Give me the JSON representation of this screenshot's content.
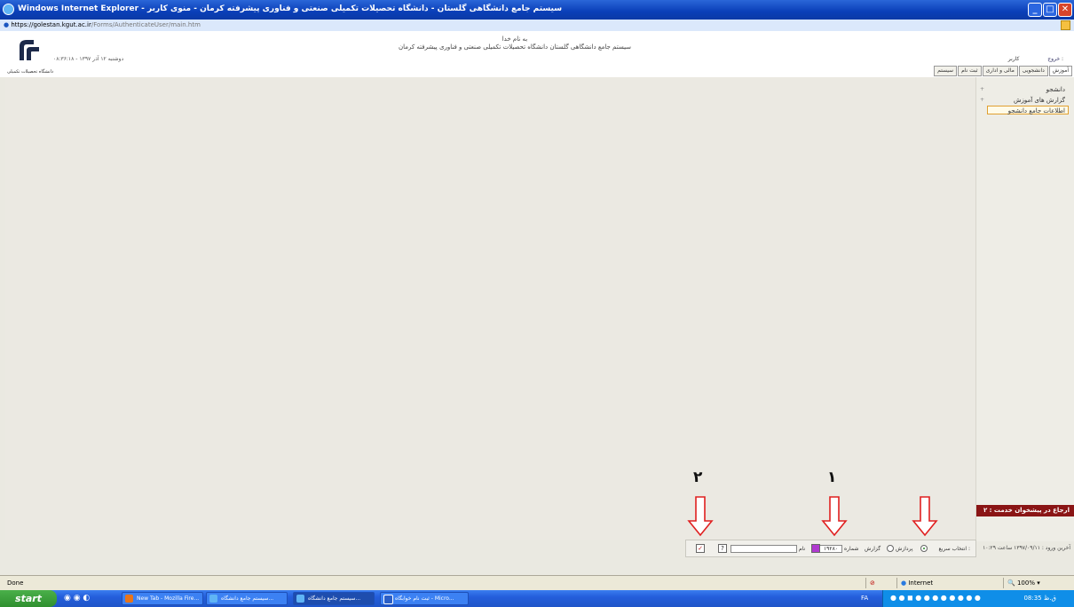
{
  "window": {
    "title": "Windows Internet Explorer - سیستم جامع دانشگاهی گلستان - دانشگاه تحصیلات تکمیلی صنعتی و فناوری پیشرفته کرمان - منوی کاربر",
    "url_prefix": "https://",
    "url_domain": "golestan.kgut.ac.ir",
    "url_path": "/Forms/AuthenticateUser/main.htm"
  },
  "header": {
    "bismillah": "به نام خدا",
    "system_name": "سیستم جامع دانشگاهی گلستان   دانشگاه تحصیلات تکمیلی صنعتی و فناوری پیشرفته کرمان",
    "date": "دوشنبه ۱۲ آذر ۱۳۹۷ - ۰۸:۳۶:۱۸",
    "user_label": "کاربر :",
    "user_name": "خروج",
    "logo_caption": "دانشگاه تحصیلات تکمیلی"
  },
  "tabs": [
    "آموزش",
    "دانشجویی",
    "مالی و اداری",
    "ثبت نام",
    "سیستم"
  ],
  "sidebar": {
    "items": [
      "دانشجو",
      "گزارش های آموزش"
    ],
    "selected": "اطلاعات جامع دانشجو",
    "service_link": "ارجاع در پیشخوان خدمت : ۲",
    "last_login": "آخرین ورود : ۱۳۹۷/۰۹/۱۱ ساعت ۱۰:۲۹"
  },
  "quickbar": {
    "label": "انتخاب سریع :",
    "radio_process": "پردازش",
    "radio_report": "گزارش",
    "number_label": "شماره",
    "number_value": "۱۹۲۸۰",
    "name_label": "نام",
    "help_glyph": "?",
    "check_glyph": "✓"
  },
  "annotations": {
    "label_1": "۱",
    "label_2": "۲",
    "arrow_color": "#e02020"
  },
  "statusbar": {
    "status": "Done",
    "zone": "Internet",
    "zoom": "100%"
  },
  "taskbar": {
    "start": "start",
    "tasks": [
      "New Tab - Mozilla Fire...",
      "سیستم جامع دانشگاه...",
      "سیستم جامع دانشگاه...",
      "ثبت نام خوابگاه - Micro..."
    ],
    "lang": "FA",
    "clock": "08:35 ق.ظ"
  }
}
